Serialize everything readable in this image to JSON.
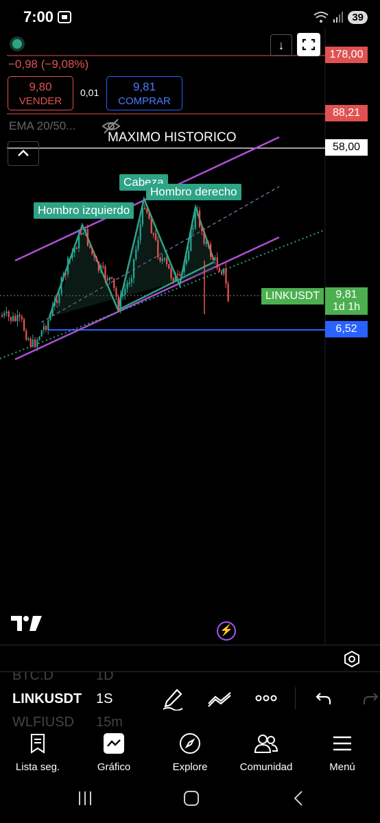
{
  "status": {
    "time": "7:00",
    "battery": "39"
  },
  "quote": {
    "change": "−0,98 (−9,08%)",
    "sell_price": "9,80",
    "sell_label": "VENDER",
    "spread": "0,01",
    "buy_price": "9,81",
    "buy_label": "COMPRAR",
    "indicator": "EMA 20/50..."
  },
  "chart": {
    "annotation_title": "MAXIMO HISTORICO",
    "pattern_labels": {
      "left_shoulder": "Hombro izquierdo",
      "head": "Cabeza",
      "right_shoulder": "Hombro derecho"
    },
    "price_axis": {
      "top_level": "178,00",
      "level_2": "88,21",
      "level_3": "58,00",
      "current": "9,81",
      "countdown": "1d 1h",
      "support": "6,52"
    },
    "symbol_tag": "LINKUSDT",
    "colors": {
      "red_level": "#e05252",
      "support_line": "#2962ff",
      "channel": "#b04fd6",
      "pattern": "#2fa386",
      "current_price": "#4caf50"
    }
  },
  "symbol_strip": {
    "rows": [
      {
        "symbol": "BTC.D",
        "interval": "1D"
      },
      {
        "symbol": "LINKUSDT",
        "interval": "1S"
      },
      {
        "symbol": "WLFIUSD",
        "interval": "15m"
      }
    ]
  },
  "nav": {
    "items": [
      {
        "label": "Lista seg.",
        "icon": "watchlist-icon"
      },
      {
        "label": "Gráfico",
        "icon": "chart-icon"
      },
      {
        "label": "Explore",
        "icon": "compass-icon"
      },
      {
        "label": "Comunidad",
        "icon": "community-icon"
      },
      {
        "label": "Menú",
        "icon": "menu-icon"
      }
    ]
  }
}
